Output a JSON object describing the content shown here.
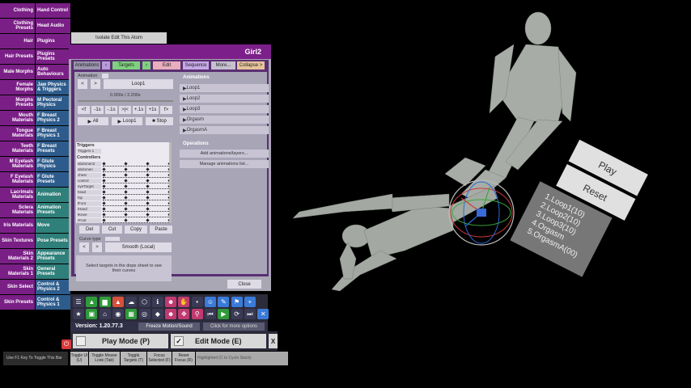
{
  "categories": [
    [
      "Clothing",
      "Hand Control"
    ],
    [
      "Clothing Presets",
      "Head Audio"
    ],
    [
      "Hair",
      "Plugins"
    ],
    [
      "Hair Presets",
      "Plugins Presets"
    ],
    [
      "Male Morphs",
      "Auto Behaviours"
    ],
    [
      "Female Morphs",
      "Jaw Physics & Triggers"
    ],
    [
      "Morphs Presets",
      "M Pectoral Physics"
    ],
    [
      "Mouth Materials",
      "F Breast Physics 2"
    ],
    [
      "Tongue Materials",
      "F Breast Physics 1"
    ],
    [
      "Teeth Materials",
      "F Breast Presets"
    ],
    [
      "M Eyelash Materials",
      "F Glute Physics"
    ],
    [
      "F Eyelash Materials",
      "F Glute Presets"
    ],
    [
      "Lacrimals Materials",
      "Animation"
    ],
    [
      "Sclera Materials",
      "Animation Presets"
    ],
    [
      "Iris Materials",
      "Move"
    ],
    [
      "Skin Textures",
      "Pose Presets"
    ],
    [
      "Skin Materials 2",
      "Appearance Presets"
    ],
    [
      "Skin Materials 1",
      "General Presets"
    ],
    [
      "Skin Select",
      "Control & Physics 2"
    ],
    [
      "Skin Presets",
      "Control & Physics 1"
    ]
  ],
  "isolate_button": "Isolate Edit This Atom",
  "panel": {
    "title": "Girl2",
    "tabs": {
      "animations": "Animations",
      "targets": "Targets",
      "edit": "Edit",
      "sequence": "Sequence",
      "more": "More...",
      "collapse": "Collapse >"
    },
    "animation_label": "Animation",
    "current_animation": "Loop1",
    "time": "0.000s / 2.200s",
    "transport": [
      "<f",
      "-1s",
      "-.1s",
      ">|<",
      "+.1s",
      "+1s",
      "f>"
    ],
    "play_all": "All",
    "play_loop": "Loop1",
    "stop": "Stop",
    "triggers_header": "Triggers",
    "trigger_row": "Triggers 1",
    "controllers_header": "Controllers",
    "controllers": [
      "abdomen2",
      "abdomen",
      "chest",
      "control",
      "eyeTarget",
      "head",
      "hip",
      "lFoot",
      "lHand",
      "lKnee",
      "rFoot"
    ],
    "edit_buttons": [
      "Del",
      "Cut",
      "Copy",
      "Paste"
    ],
    "curve_type_label": "Curve type",
    "curve_value": "Smooth (Local)",
    "help_text": "Select targets in the dope sheet to see their curves",
    "right_header": "Animations",
    "animations": [
      "Loop1",
      "Loop2",
      "Loop3",
      "Orgasm",
      "OrgasmA"
    ],
    "operations_header": "Operations",
    "operations": [
      "Add animations/layers...",
      "Manage animations list..."
    ],
    "close": "Close"
  },
  "version": "Version: 1.20.77.3",
  "freeze": "Freeze Motion/Sound",
  "more_options": "Click for more options",
  "play_mode": "Play Mode (P)",
  "edit_mode": "Edit Mode (E)",
  "close_x": "X",
  "bottom_bar": {
    "hint": "Use F1 Key To Toggle This Bar",
    "toggle_ui": "Toggle UI (U)",
    "toggle_mouse": "Toggle Mouse Look (Tab)",
    "toggle_targets": "Toggle Targets (T)",
    "focus": "Focus Selected (F)",
    "reset": "Reset Focus (R)",
    "highlighted": "Highlighted (C to Cycle Stack)"
  },
  "scene_panel": {
    "play": "Play",
    "reset": "Reset",
    "list": [
      "1.Loop1(10)",
      "2.Loop2(10)",
      "3.Loop3(10)",
      "4.Orgasm",
      "5.OrgasmA(00)"
    ]
  },
  "colors": {
    "panel_head": "#7c1f8a",
    "tab_green": "#7fd17f",
    "category_purple": "#7a1f86",
    "category_blue": "#2d5c8c",
    "category_teal": "#2f7f7a"
  }
}
